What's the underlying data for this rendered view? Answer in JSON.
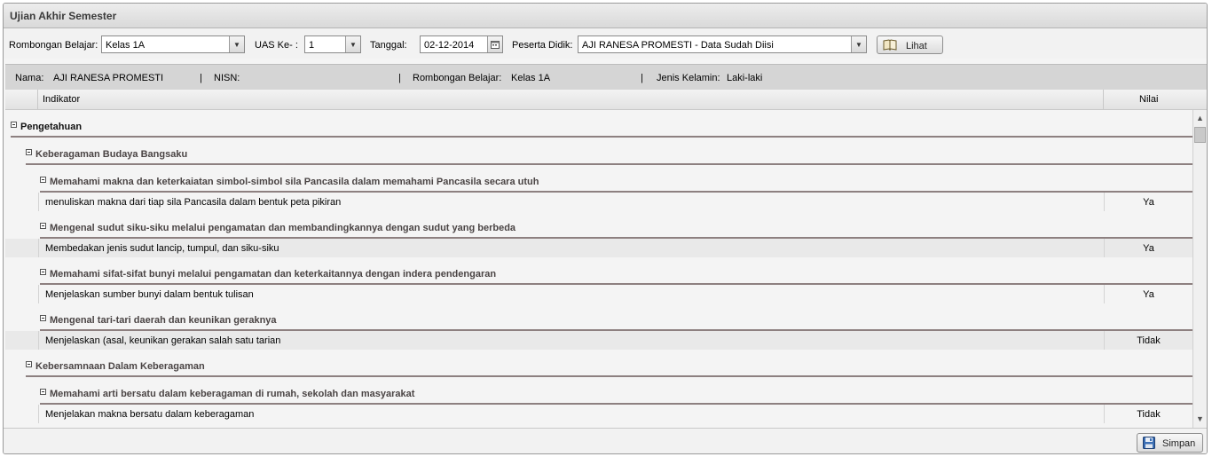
{
  "window": {
    "title": "Ujian Akhir Semester"
  },
  "filters": {
    "rombel_label": "Rombongan Belajar:",
    "rombel_value": "Kelas 1A",
    "uas_label": "UAS Ke- :",
    "uas_value": "1",
    "tanggal_label": "Tanggal:",
    "tanggal_value": "02-12-2014",
    "peserta_label": "Peserta Didik:",
    "peserta_value": "AJI RANESA PROMESTI - Data Sudah Diisi",
    "lihat_label": "Lihat"
  },
  "info": {
    "nama_label": "Nama:",
    "nama_value": "AJI RANESA PROMESTI",
    "nisn_label": "NISN:",
    "rombel_label": "Rombongan Belajar:",
    "rombel_value": "Kelas 1A",
    "jk_label": "Jenis Kelamin:",
    "jk_value": "Laki-laki",
    "sep": "|"
  },
  "grid": {
    "col_indikator": "Indikator",
    "col_nilai": "Nilai",
    "rows": [
      {
        "type": "group",
        "level": 0,
        "text": "Pengetahuan"
      },
      {
        "type": "group",
        "level": 1,
        "text": "Keberagaman Budaya Bangsaku"
      },
      {
        "type": "group",
        "level": 2,
        "text": "Memahami makna dan keterkaiatan simbol-simbol sila Pancasila dalam memahami Pancasila secara utuh"
      },
      {
        "type": "data",
        "text": "menuliskan makna dari tiap sila Pancasila dalam bentuk peta pikiran",
        "nilai": "Ya"
      },
      {
        "type": "group",
        "level": 2,
        "text": "Mengenal sudut siku-siku melalui pengamatan dan membandingkannya dengan sudut yang berbeda"
      },
      {
        "type": "data",
        "text": "Membedakan jenis sudut lancip, tumpul, dan siku-siku",
        "nilai": "Ya"
      },
      {
        "type": "group",
        "level": 2,
        "text": "Memahami sifat-sifat bunyi melalui pengamatan dan keterkaitannya dengan indera pendengaran"
      },
      {
        "type": "data",
        "text": "Menjelaskan sumber bunyi dalam bentuk tulisan",
        "nilai": "Ya"
      },
      {
        "type": "group",
        "level": 2,
        "text": "Mengenal tari-tari daerah dan keunikan geraknya"
      },
      {
        "type": "data",
        "text": "Menjelaskan (asal, keunikan gerakan salah satu tarian",
        "nilai": "Tidak"
      },
      {
        "type": "group",
        "level": 1,
        "text": "Kebersamnaan Dalam Keberagaman"
      },
      {
        "type": "group",
        "level": 2,
        "text": "Memahami arti bersatu dalam keberagaman di rumah, sekolah dan masyarakat"
      },
      {
        "type": "data",
        "text": "Menjelakan makna bersatu dalam keberagaman",
        "nilai": "Tidak"
      }
    ]
  },
  "footer": {
    "simpan_label": "Simpan"
  }
}
